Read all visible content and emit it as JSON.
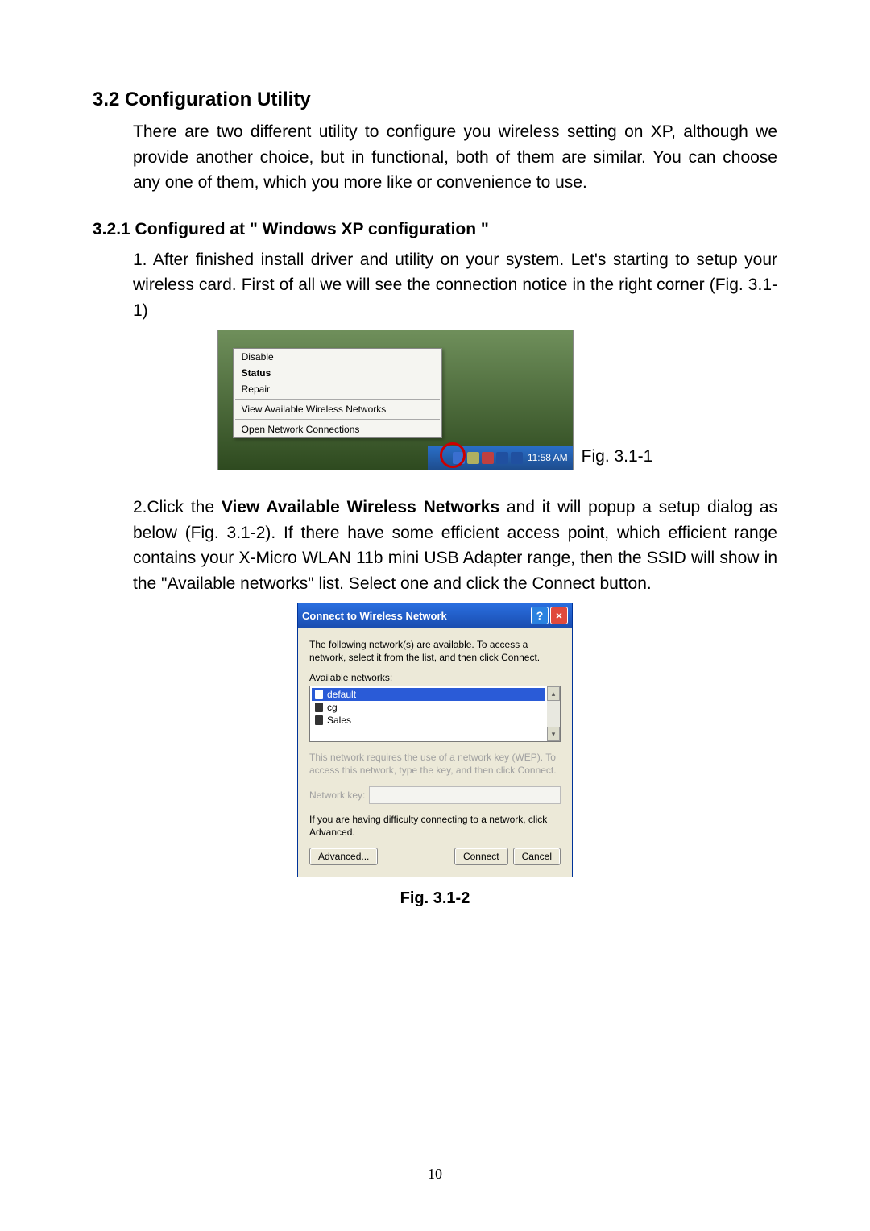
{
  "section_heading": "3.2 Configuration Utility",
  "section_body": "There are two different utility to configure you wireless setting on XP, although we provide another choice, but in functional, both of them are similar. You can choose any one of them, which you more like or convenience to use.",
  "sub_heading": "3.2.1 Configured at \" Windows XP configuration \"",
  "step1": "1. After finished install driver and utility on your system. Let's starting to setup your wireless card. First of all we will see the connection notice in the right corner (Fig. 3.1-1)",
  "menu": {
    "disable": "Disable",
    "status": "Status",
    "repair": "Repair",
    "view_networks": "View Available Wireless Networks",
    "open_connections": "Open Network Connections"
  },
  "tray_time": "11:58 AM",
  "fig1_caption": "Fig. 3.1-1",
  "step2_pre": "2.Click the ",
  "step2_bold": "View Available Wireless Networks",
  "step2_post": " and it will popup a setup dialog as below (Fig. 3.1-2). If there have some efficient access point, which efficient range contains your X-Micro WLAN 11b mini USB Adapter range, then the SSID will show in the \"Available networks\" list. Select one and click the Connect button.",
  "dialog": {
    "title": "Connect to Wireless Network",
    "intro": "The following network(s) are available. To access a network, select it from the list, and then click Connect.",
    "available_label": "Available networks:",
    "items": [
      "default",
      "cg",
      "Sales"
    ],
    "wep_text": "This network requires the use of a network key (WEP). To access this network, type the key, and then click Connect.",
    "key_label": "Network key:",
    "difficulty_text": "If you are having difficulty connecting to a network, click Advanced.",
    "advanced_btn": "Advanced...",
    "connect_btn": "Connect",
    "cancel_btn": "Cancel"
  },
  "fig2_caption": "Fig. 3.1-2",
  "page_number": "10"
}
